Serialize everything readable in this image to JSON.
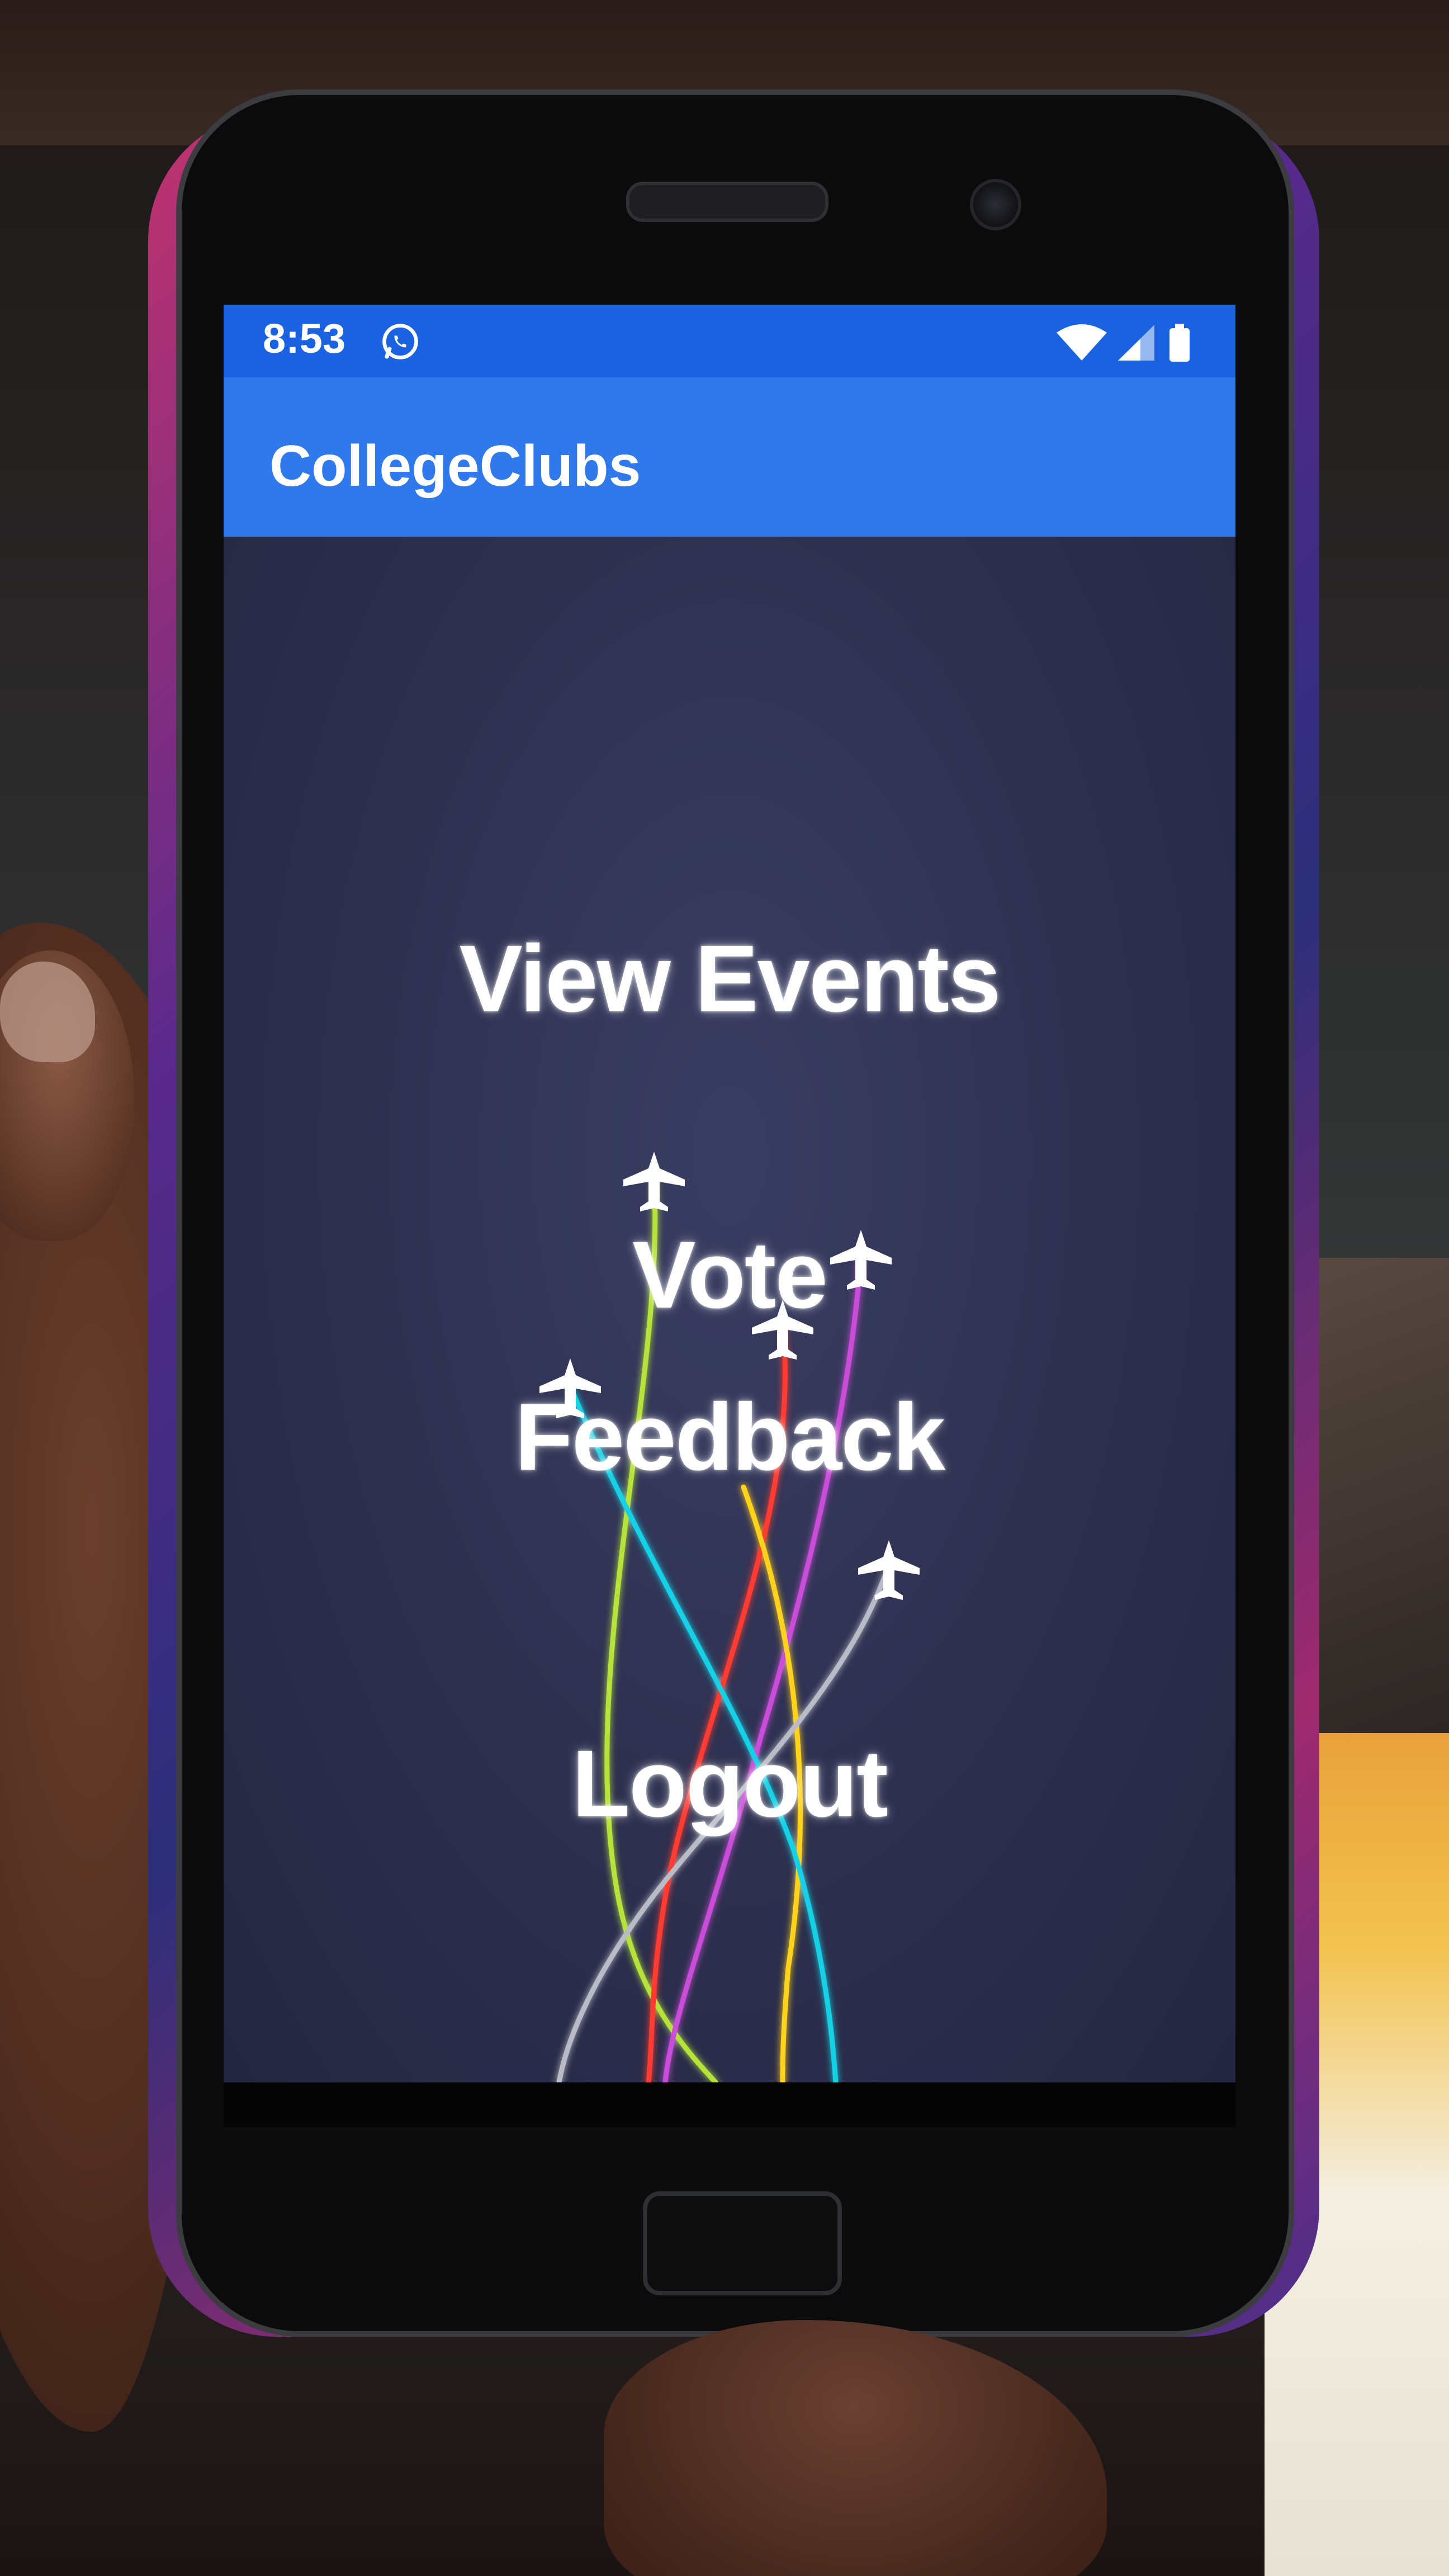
{
  "status_bar": {
    "time": "8:53",
    "icons": [
      "whatsapp-icon",
      "wifi-icon",
      "signal-icon",
      "battery-icon"
    ],
    "color": "#1a62e0"
  },
  "app_bar": {
    "title": "CollegeClubs",
    "color": "#2f79ea"
  },
  "menu": {
    "view_events": "View Events",
    "vote": "Vote",
    "feedback": "Feedback",
    "logout": "Logout"
  },
  "background": {
    "color": "#2c2f4a",
    "decoration": "airplane-trails-icon"
  }
}
